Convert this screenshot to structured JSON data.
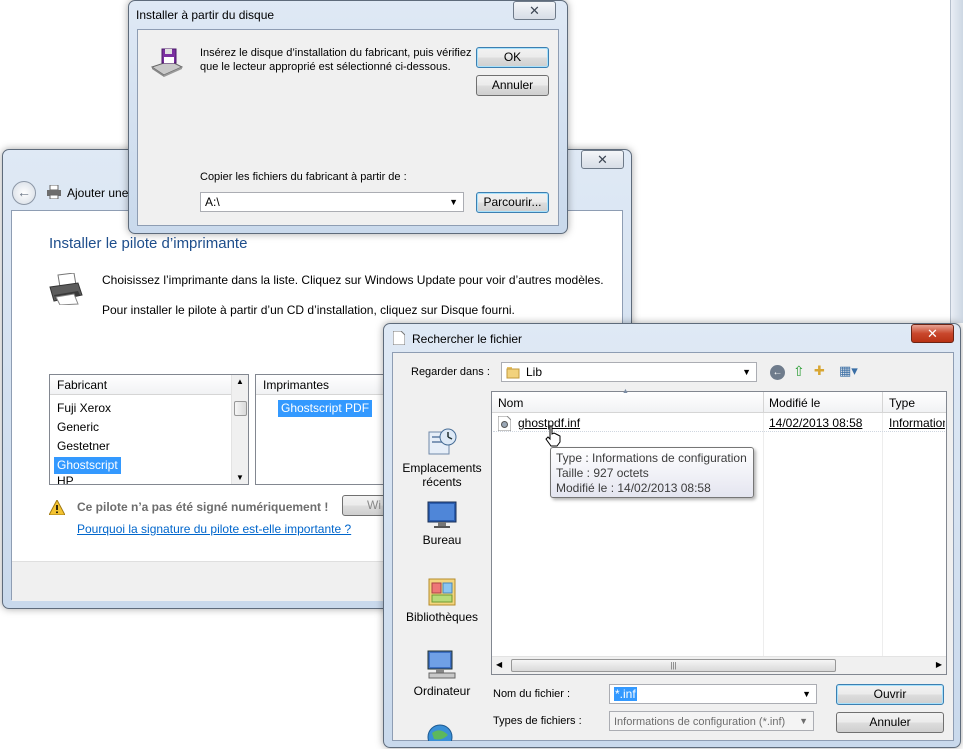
{
  "wizard": {
    "title": "Ajouter une",
    "heading": "Installer le pilote d’imprimante",
    "line1": "Choisissez l’imprimante dans la liste. Cliquez sur Windows Update pour voir d’autres modèles.",
    "line2": "Pour installer le pilote à partir d’un CD d’installation, cliquez sur Disque fourni.",
    "manufacturer_header": "Fabricant",
    "manufacturers": [
      "Fuji Xerox",
      "Generic",
      "Gestetner",
      "Ghostscript",
      "HP"
    ],
    "selected_manufacturer": "Ghostscript",
    "printers_header": "Imprimantes",
    "printers": [
      "Ghostscript PDF"
    ],
    "warning_text": "Ce pilote n’a pas été signé numériquement !",
    "warning_link": "Pourquoi la signature du pilote est-elle importante ?",
    "windows_update_label": "Wi"
  },
  "disk_dialog": {
    "title": "Installer à partir du disque",
    "message_line1": "Insérez le disque d’installation du fabricant, puis vérifiez",
    "message_line2": "que le lecteur approprié est sélectionné ci-dessous.",
    "ok_label": "OK",
    "cancel_label": "Annuler",
    "copy_label": "Copier les fichiers du fabricant à partir de :",
    "path_value": "A:\\",
    "browse_label": "Parcourir..."
  },
  "browse_dialog": {
    "title": "Rechercher le fichier",
    "look_in_label": "Regarder dans :",
    "look_in_value": "Lib",
    "places": [
      {
        "label_line1": "Emplacements",
        "label_line2": "récents"
      },
      {
        "label_line1": "Bureau",
        "label_line2": ""
      },
      {
        "label_line1": "Bibliothèques",
        "label_line2": ""
      },
      {
        "label_line1": "Ordinateur",
        "label_line2": ""
      }
    ],
    "columns": {
      "name": "Nom",
      "modified": "Modifié le",
      "type": "Type"
    },
    "file": {
      "name": "ghostpdf.inf",
      "modified": "14/02/2013 08:58",
      "type": "Information"
    },
    "tooltip": {
      "line1": "Type : Informations de configuration",
      "line2": "Taille : 927 octets",
      "line3": "Modifié le : 14/02/2013 08:58"
    },
    "filename_label": "Nom du fichier :",
    "filename_value": "*.inf",
    "filetype_label": "Types de fichiers :",
    "filetype_value": "Informations de configuration (*.inf)",
    "open_label": "Ouvrir",
    "cancel_label": "Annuler"
  },
  "colors": {
    "heading_blue": "#1e4e8c",
    "selection": "#3399ff",
    "link": "#0066cc"
  }
}
